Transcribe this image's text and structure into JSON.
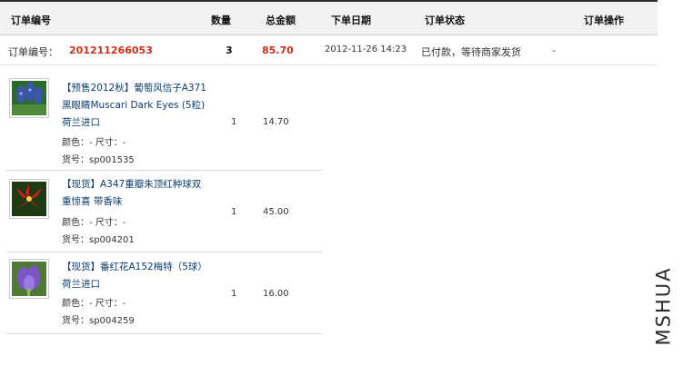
{
  "header": {
    "col_order_no": "订单编号",
    "col_qty": "数量",
    "col_total": "总金额",
    "col_date": "下单日期",
    "col_status": "订单状态",
    "col_action": "订单操作"
  },
  "order": {
    "label": "订单编号：",
    "number": "201211266053",
    "qty": "3",
    "total": "85.70",
    "date": "2012-11-26 14:23",
    "status": "已付款，等待商家发货",
    "action": "-"
  },
  "items": [
    {
      "title": "【预售2012秋】葡萄风信子A371黑眼睛Muscari Dark Eyes (5粒)荷兰进口",
      "attrs": "颜色：- 尺寸：-",
      "sku": "货号：sp001535",
      "qty": "1",
      "price": "14.70",
      "thumb_color": "#3b57a8"
    },
    {
      "title": "【现货】A347重瓣朱顶红种球双重惊喜 带香味",
      "attrs": "颜色：- 尺寸：-",
      "sku": "货号：sp004201",
      "qty": "1",
      "price": "45.00",
      "thumb_color": "#c81e1e"
    },
    {
      "title": "【现货】番红花A152梅特（5球） 荷兰进口",
      "attrs": "颜色：- 尺寸：-",
      "sku": "货号：sp004259",
      "qty": "1",
      "price": "16.00",
      "thumb_color": "#7b55c4"
    }
  ],
  "watermark": "MSHUA"
}
